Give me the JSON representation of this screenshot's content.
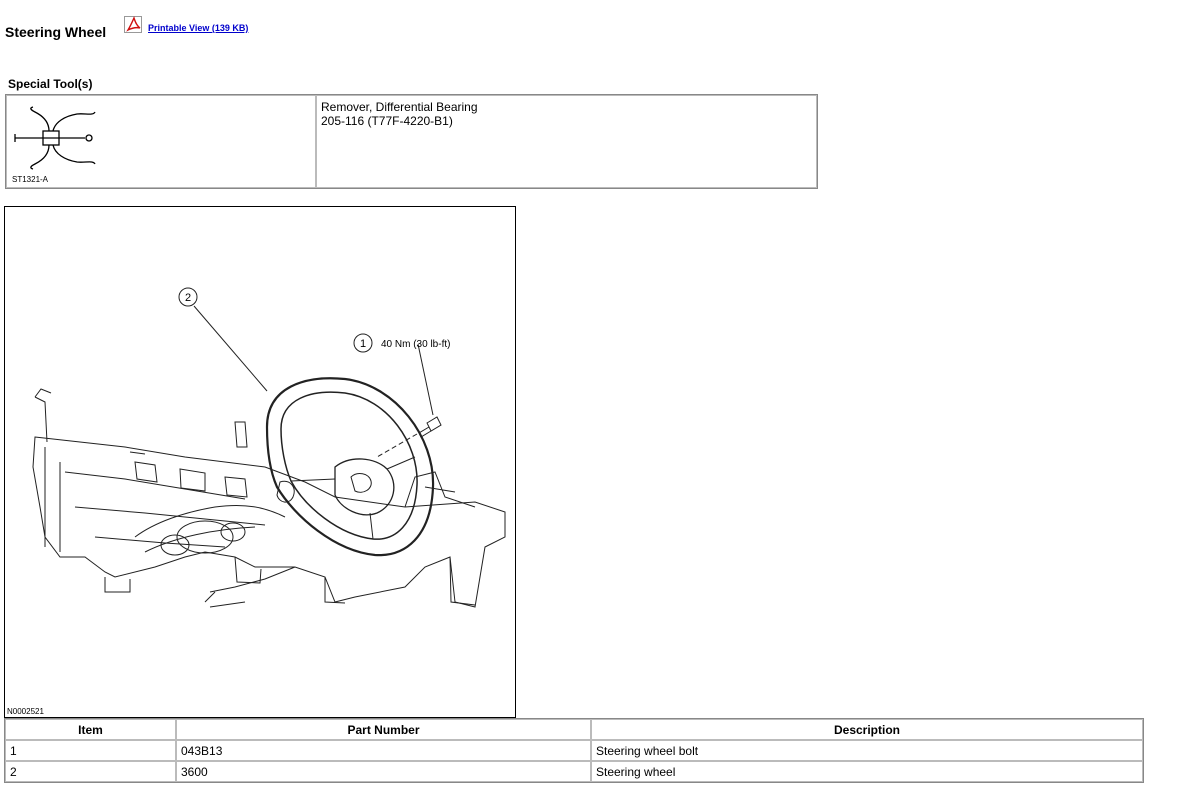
{
  "header": {
    "title": "Steering Wheel",
    "printable_label": "Printable View (139 KB)",
    "pdf_icon": "pdf-icon"
  },
  "special_tools": {
    "heading": "Special Tool(s)",
    "items": [
      {
        "image_code": "ST1321-A",
        "name": "Remover, Differential Bearing",
        "number": "205-116 (T77F-4220-B1)"
      }
    ]
  },
  "figure": {
    "code": "N0002521",
    "callouts": [
      {
        "number": "2",
        "label": ""
      },
      {
        "number": "1",
        "label": "40 Nm (30 lb-ft)"
      }
    ]
  },
  "parts_table": {
    "headers": [
      "Item",
      "Part Number",
      "Description"
    ],
    "rows": [
      {
        "item": "1",
        "part_number": "043B13",
        "description": "Steering wheel bolt"
      },
      {
        "item": "2",
        "part_number": "3600",
        "description": "Steering wheel"
      }
    ]
  }
}
